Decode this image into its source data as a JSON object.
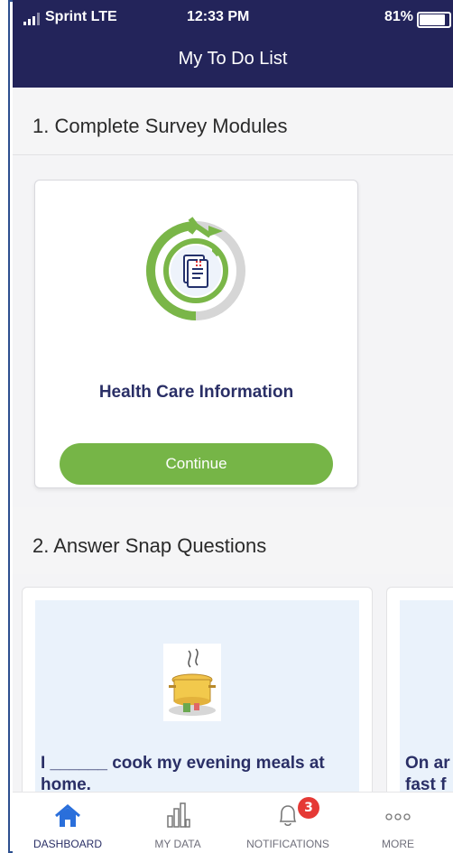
{
  "status_bar": {
    "carrier": "Sprint  LTE",
    "time": "12:33 PM",
    "battery": "81%",
    "battery_level": 0.81
  },
  "header": {
    "title": "My To Do List"
  },
  "sections": [
    {
      "title": "1. Complete Survey Modules"
    },
    {
      "title": "2. Answer Snap Questions"
    }
  ],
  "survey_card": {
    "title": "Health Care Information",
    "button_label": "Continue",
    "progress_color": "#7ab648"
  },
  "snap_cards": [
    {
      "question": "I ______ cook my evening meals at home."
    },
    {
      "question": "On ar fast f"
    }
  ],
  "tabbar": {
    "items": [
      {
        "label": "DASHBOARD",
        "icon": "home-icon",
        "active": true
      },
      {
        "label": "MY DATA",
        "icon": "bar-chart-icon",
        "active": false
      },
      {
        "label": "NOTIFICATIONS",
        "icon": "bell-icon",
        "active": false,
        "badge": "3"
      },
      {
        "label": "MORE",
        "icon": "more-icon",
        "active": false
      }
    ]
  },
  "colors": {
    "header_bg": "#23245a",
    "accent_green": "#76b547",
    "tab_active": "#2a6fdb",
    "badge_red": "#e53935"
  }
}
